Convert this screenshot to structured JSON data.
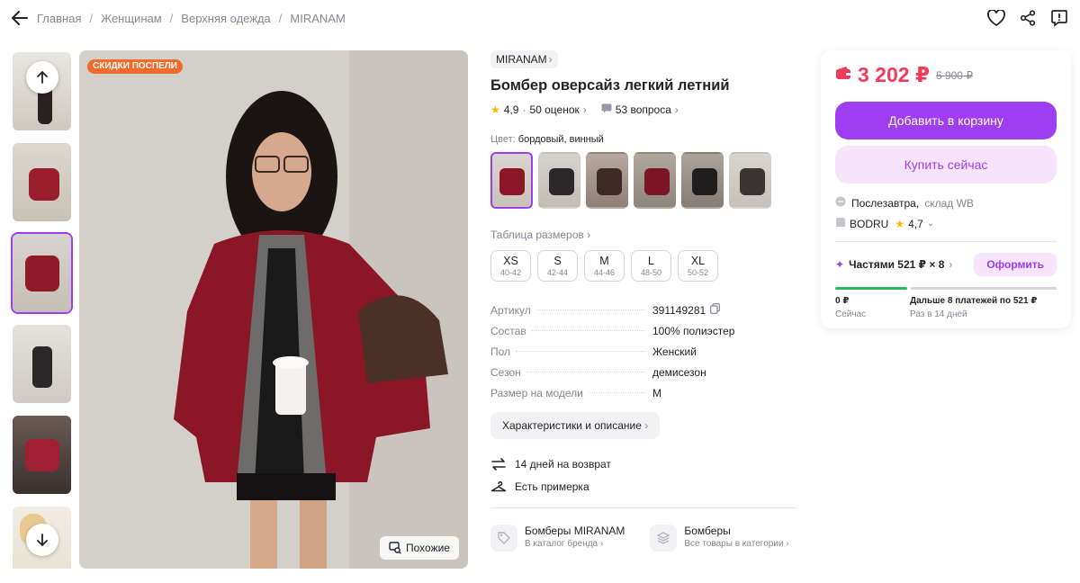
{
  "breadcrumbs": [
    "Главная",
    "Женщинам",
    "Верхняя одежда",
    "MIRANAM"
  ],
  "badge": "СКИДКИ ПОСПЕЛИ",
  "similar_label": "Похожие",
  "product": {
    "brand": "MIRANAM",
    "title": "Бомбер оверсайз легкий летний",
    "rating": "4,9",
    "reviews": "50 оценок",
    "questions": "53 вопроса",
    "color_label": "Цвет:",
    "color_value": "бордовый, винный",
    "size_table_label": "Таблица размеров",
    "sizes": [
      {
        "size": "XS",
        "range": "40-42"
      },
      {
        "size": "S",
        "range": "42-44"
      },
      {
        "size": "M",
        "range": "44-46"
      },
      {
        "size": "L",
        "range": "48-50"
      },
      {
        "size": "XL",
        "range": "50-52"
      }
    ],
    "params": [
      {
        "key": "Артикул",
        "value": "391149281"
      },
      {
        "key": "Состав",
        "value": "100% полиэстер"
      },
      {
        "key": "Пол",
        "value": "Женский"
      },
      {
        "key": "Сезон",
        "value": "демисезон"
      },
      {
        "key": "Размер на модели",
        "value": "M"
      }
    ],
    "characteristics_btn": "Характеристики и описание",
    "perks": [
      "14 дней на возврат",
      "Есть примерка"
    ],
    "links": [
      {
        "title": "Бомберы MIRANAM",
        "sub": "В каталог бренда"
      },
      {
        "title": "Бомберы",
        "sub": "Все товары в категории"
      }
    ]
  },
  "buy": {
    "price": "3 202 ₽",
    "old_price": "5 900 ₽",
    "add_to_cart": "Добавить в корзину",
    "buy_now": "Купить сейчас",
    "delivery_day": "Послезавтра,",
    "delivery_wh": "склад WB",
    "seller": "BODRU",
    "seller_rating": "4,7",
    "installments": "Частями 521 ₽ × 8",
    "installments_btn": "Оформить",
    "now_amount": "0 ₽",
    "now_label": "Сейчас",
    "later_amount": "Дальше 8 платежей по 521 ₽",
    "later_label": "Раз в 14 дней"
  },
  "colors": {
    "accent": "#9f3ef0",
    "price": "#f43a5b",
    "badge": "#f26b2a"
  }
}
